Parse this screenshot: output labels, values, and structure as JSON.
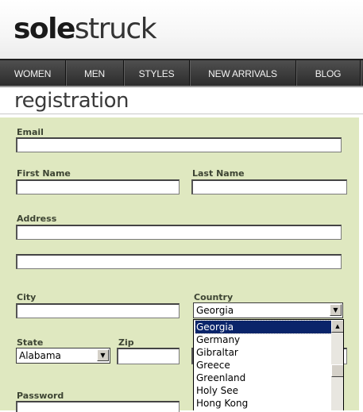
{
  "brand": {
    "logo_bold": "sole",
    "logo_light": "struck"
  },
  "nav": {
    "items": [
      {
        "label": "WOMEN"
      },
      {
        "label": "MEN"
      },
      {
        "label": "STYLES"
      },
      {
        "label": "NEW ARRIVALS"
      },
      {
        "label": "BLOG"
      }
    ]
  },
  "page": {
    "title": "registration"
  },
  "form": {
    "email_label": "Email",
    "first_name_label": "First Name",
    "last_name_label": "Last Name",
    "address_label": "Address",
    "city_label": "City",
    "country_label": "Country",
    "country_value": "Georgia",
    "state_label": "State",
    "state_value": "Alabama",
    "zip_label": "Zip",
    "password_label": "Password",
    "country_options": [
      "Georgia",
      "Germany",
      "Gibraltar",
      "Greece",
      "Greenland",
      "Holy See",
      "Hong Kong"
    ],
    "selected_option": "Georgia"
  },
  "colors": {
    "panel_bg": "#dfe8c0",
    "nav_bg": "#3a3a3a",
    "selection": "#0a246a"
  },
  "icons": [
    "chevron-down-icon",
    "scroll-up-icon",
    "scroll-down-icon"
  ]
}
